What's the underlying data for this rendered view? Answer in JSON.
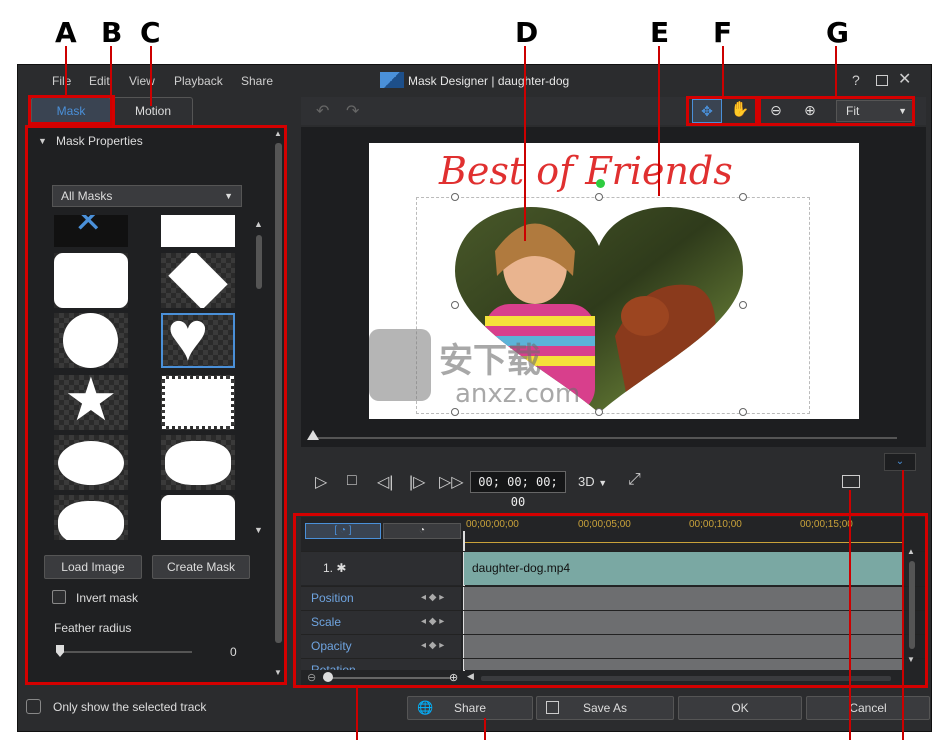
{
  "callouts": {
    "a": "A",
    "b": "B",
    "c": "C",
    "d": "D",
    "e": "E",
    "f": "F",
    "g": "G"
  },
  "window": {
    "title": "Mask Designer  |  daughter-dog",
    "help": "?"
  },
  "menu": {
    "file": "File",
    "edit": "Edit",
    "view": "View",
    "playback": "Playback",
    "share": "Share"
  },
  "tabs": {
    "mask": "Mask",
    "motion": "Motion"
  },
  "mask_panel": {
    "section": "Mask Properties",
    "dropdown": "All Masks",
    "load_image": "Load Image",
    "create_mask": "Create Mask",
    "invert_mask": "Invert mask",
    "feather_label": "Feather radius",
    "feather_value": "0"
  },
  "preview": {
    "zoom": "Fit",
    "title_text": "Best of Friends",
    "watermark": "anxz.com",
    "watermark_cn": "安下载"
  },
  "playback": {
    "timecode": "00; 00; 00; 00",
    "mode": "3D"
  },
  "timeline": {
    "ruler": [
      "00;00;00;00",
      "00;00;05;00",
      "00;00;10;00",
      "00;00;15;00"
    ],
    "track_label": "1.",
    "clip": "daughter-dog.mp4",
    "rows": [
      "Position",
      "Scale",
      "Opacity",
      "Rotation"
    ]
  },
  "footer": {
    "only_selected": "Only show the selected track",
    "share": "Share",
    "save_as": "Save As",
    "ok": "OK",
    "cancel": "Cancel"
  },
  "colors": {
    "accent": "#4a90d9",
    "callout_red": "#d40000",
    "clip": "#7aa8a3"
  }
}
